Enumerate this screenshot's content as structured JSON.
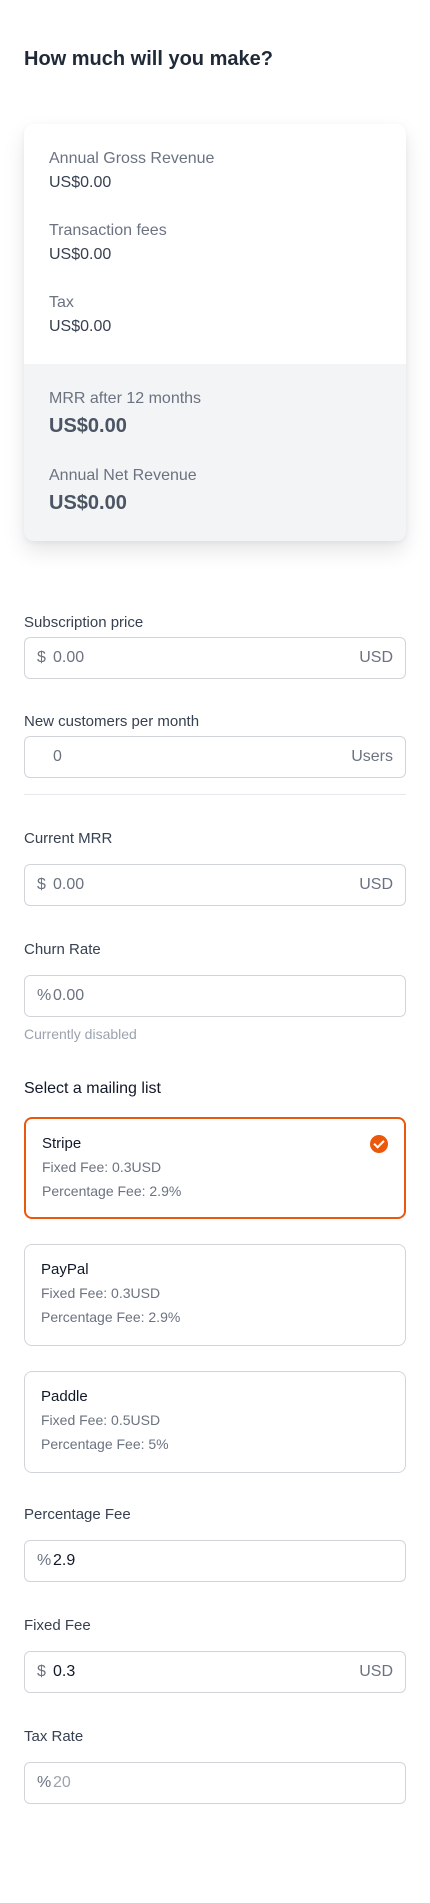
{
  "page": {
    "title": "How much will you make?"
  },
  "summary": {
    "gross_label": "Annual Gross Revenue",
    "gross_value": "US$0.00",
    "fees_label": "Transaction fees",
    "fees_value": "US$0.00",
    "tax_label": "Tax",
    "tax_value": "US$0.00",
    "mrr_label": "MRR after 12 months",
    "mrr_value": "US$0.00",
    "net_label": "Annual Net Revenue",
    "net_value": "US$0.00"
  },
  "form": {
    "subscription": {
      "label": "Subscription price",
      "prefix": "$",
      "placeholder": "0.00",
      "suffix": "USD"
    },
    "customers": {
      "label": "New customers per month",
      "placeholder": "0",
      "suffix": "Users"
    },
    "current_mrr": {
      "label": "Current MRR",
      "prefix": "$",
      "placeholder": "0.00",
      "suffix": "USD"
    },
    "churn": {
      "label": "Churn Rate",
      "prefix": "%",
      "placeholder": "0.00",
      "helper": "Currently disabled"
    },
    "percentage_fee": {
      "label": "Percentage Fee",
      "prefix": "%",
      "value": "2.9"
    },
    "fixed_fee": {
      "label": "Fixed Fee",
      "prefix": "$",
      "value": "0.3",
      "suffix": "USD"
    },
    "tax_rate": {
      "label": "Tax Rate",
      "prefix": "%",
      "placeholder": "20"
    }
  },
  "mailing": {
    "title": "Select a mailing list",
    "options": [
      {
        "name": "Stripe",
        "fixed": "Fixed Fee: 0.3USD",
        "percent": "Percentage Fee: 2.9%",
        "selected": true
      },
      {
        "name": "PayPal",
        "fixed": "Fixed Fee: 0.3USD",
        "percent": "Percentage Fee: 2.9%",
        "selected": false
      },
      {
        "name": "Paddle",
        "fixed": "Fixed Fee: 0.5USD",
        "percent": "Percentage Fee: 5%",
        "selected": false
      }
    ]
  },
  "colors": {
    "accent": "#ea580c",
    "border": "#d1d5db",
    "muted_bg": "#f3f4f6"
  }
}
